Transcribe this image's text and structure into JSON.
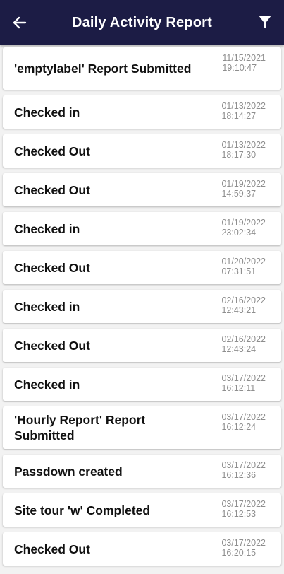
{
  "header": {
    "title": "Daily Activity Report",
    "back_icon": "arrow-left-icon",
    "filter_icon": "filter-icon"
  },
  "colors": {
    "appbar": "#1c1c45",
    "background": "#f2f2f2",
    "timestamp": "#8e8e8e"
  },
  "items": [
    {
      "label": "'emptylabel' Report Submitted",
      "date": "11/15/2021",
      "time": "19:10:47"
    },
    {
      "label": "Checked in",
      "date": "01/13/2022",
      "time": "18:14:27"
    },
    {
      "label": "Checked Out",
      "date": "01/13/2022",
      "time": "18:17:30"
    },
    {
      "label": "Checked Out",
      "date": "01/19/2022",
      "time": "14:59:37"
    },
    {
      "label": "Checked in",
      "date": "01/19/2022",
      "time": "23:02:34"
    },
    {
      "label": "Checked Out",
      "date": "01/20/2022",
      "time": "07:31:51"
    },
    {
      "label": "Checked in",
      "date": "02/16/2022",
      "time": "12:43:21"
    },
    {
      "label": "Checked Out",
      "date": "02/16/2022",
      "time": "12:43:24"
    },
    {
      "label": "Checked in",
      "date": "03/17/2022",
      "time": "16:12:11"
    },
    {
      "label": "'Hourly Report' Report Submitted",
      "date": "03/17/2022",
      "time": "16:12:24"
    },
    {
      "label": "Passdown created",
      "date": "03/17/2022",
      "time": "16:12:36"
    },
    {
      "label": "Site tour 'w' Completed",
      "date": "03/17/2022",
      "time": "16:12:53"
    },
    {
      "label": "Checked Out",
      "date": "03/17/2022",
      "time": "16:20:15"
    }
  ]
}
